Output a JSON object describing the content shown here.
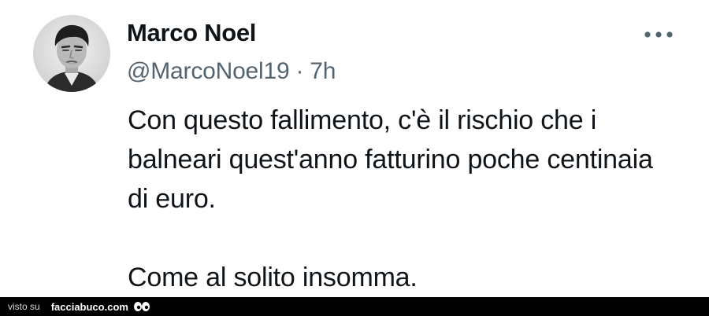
{
  "tweet": {
    "display_name": "Marco Noel",
    "handle": "@MarcoNoel19",
    "separator": "·",
    "time_ago": "7h",
    "text_paragraphs": [
      "Con questo fallimento, c'è il rischio che i balneari quest'anno fatturino poche centinaia di euro.",
      "Come al solito insomma."
    ],
    "more_icon": "more-dots-icon"
  },
  "watermark": {
    "prefix": "visto su",
    "site": "facciabuco.com",
    "logo_icon": "eyes-icon"
  },
  "colors": {
    "name": "#0f1419",
    "secondary": "#536471",
    "footer_bg": "#000000"
  }
}
